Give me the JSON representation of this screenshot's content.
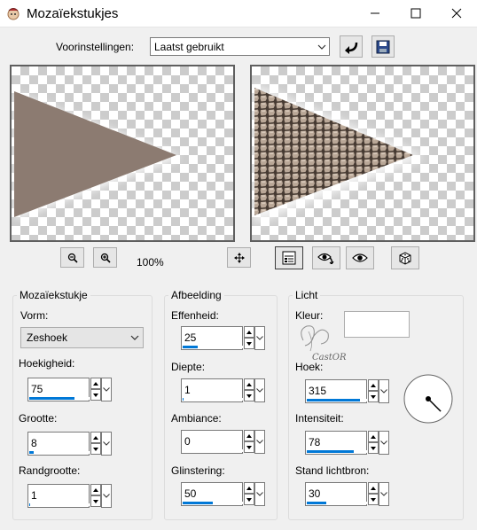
{
  "window": {
    "title": "Mozaïekstukjes"
  },
  "presets": {
    "label": "Voorinstellingen:",
    "selected": "Laatst gebruikt"
  },
  "zoom": {
    "level": "100%"
  },
  "groups": {
    "mosaic": {
      "title": "Mozaïekstukje",
      "shape_label": "Vorm:",
      "shape_value": "Zeshoek",
      "angularity_label": "Hoekigheid:",
      "angularity_value": "75",
      "size_label": "Grootte:",
      "size_value": "8",
      "border_label": "Randgrootte:",
      "border_value": "1"
    },
    "image": {
      "title": "Afbeelding",
      "smoothness_label": "Effenheid:",
      "smoothness_value": "25",
      "depth_label": "Diepte:",
      "depth_value": "1",
      "ambience_label": "Ambiance:",
      "ambience_value": "0",
      "shininess_label": "Glinstering:",
      "shininess_value": "50"
    },
    "light": {
      "title": "Licht",
      "color_label": "Kleur:",
      "angle_label": "Hoek:",
      "angle_value": "315",
      "intensity_label": "Intensiteit:",
      "intensity_value": "78",
      "elevation_label": "Stand lichtbron:",
      "elevation_value": "30"
    }
  },
  "watermark": {
    "text": "CastOR"
  },
  "slider_levels": {
    "angularity": 0.75,
    "size": 0.08,
    "border": 0.01,
    "smoothness": 0.25,
    "depth": 0.01,
    "ambience": 0.0,
    "shininess": 0.5,
    "angle": 0.875,
    "intensity": 0.78,
    "elevation": 0.33
  },
  "colors": {
    "accent": "#0078d7",
    "triangle": "#8c7b71",
    "mosaic": "#b5a393",
    "light_color": "#ffffff"
  },
  "icons": [
    "app-icon",
    "minimize-icon",
    "maximize-icon",
    "close-icon",
    "reset-icon",
    "save-icon",
    "zoom-out-icon",
    "zoom-in-icon",
    "pan-icon",
    "settings-panel-icon",
    "eye-refresh-icon",
    "eye-icon",
    "dice-icon",
    "dial-icon"
  ]
}
